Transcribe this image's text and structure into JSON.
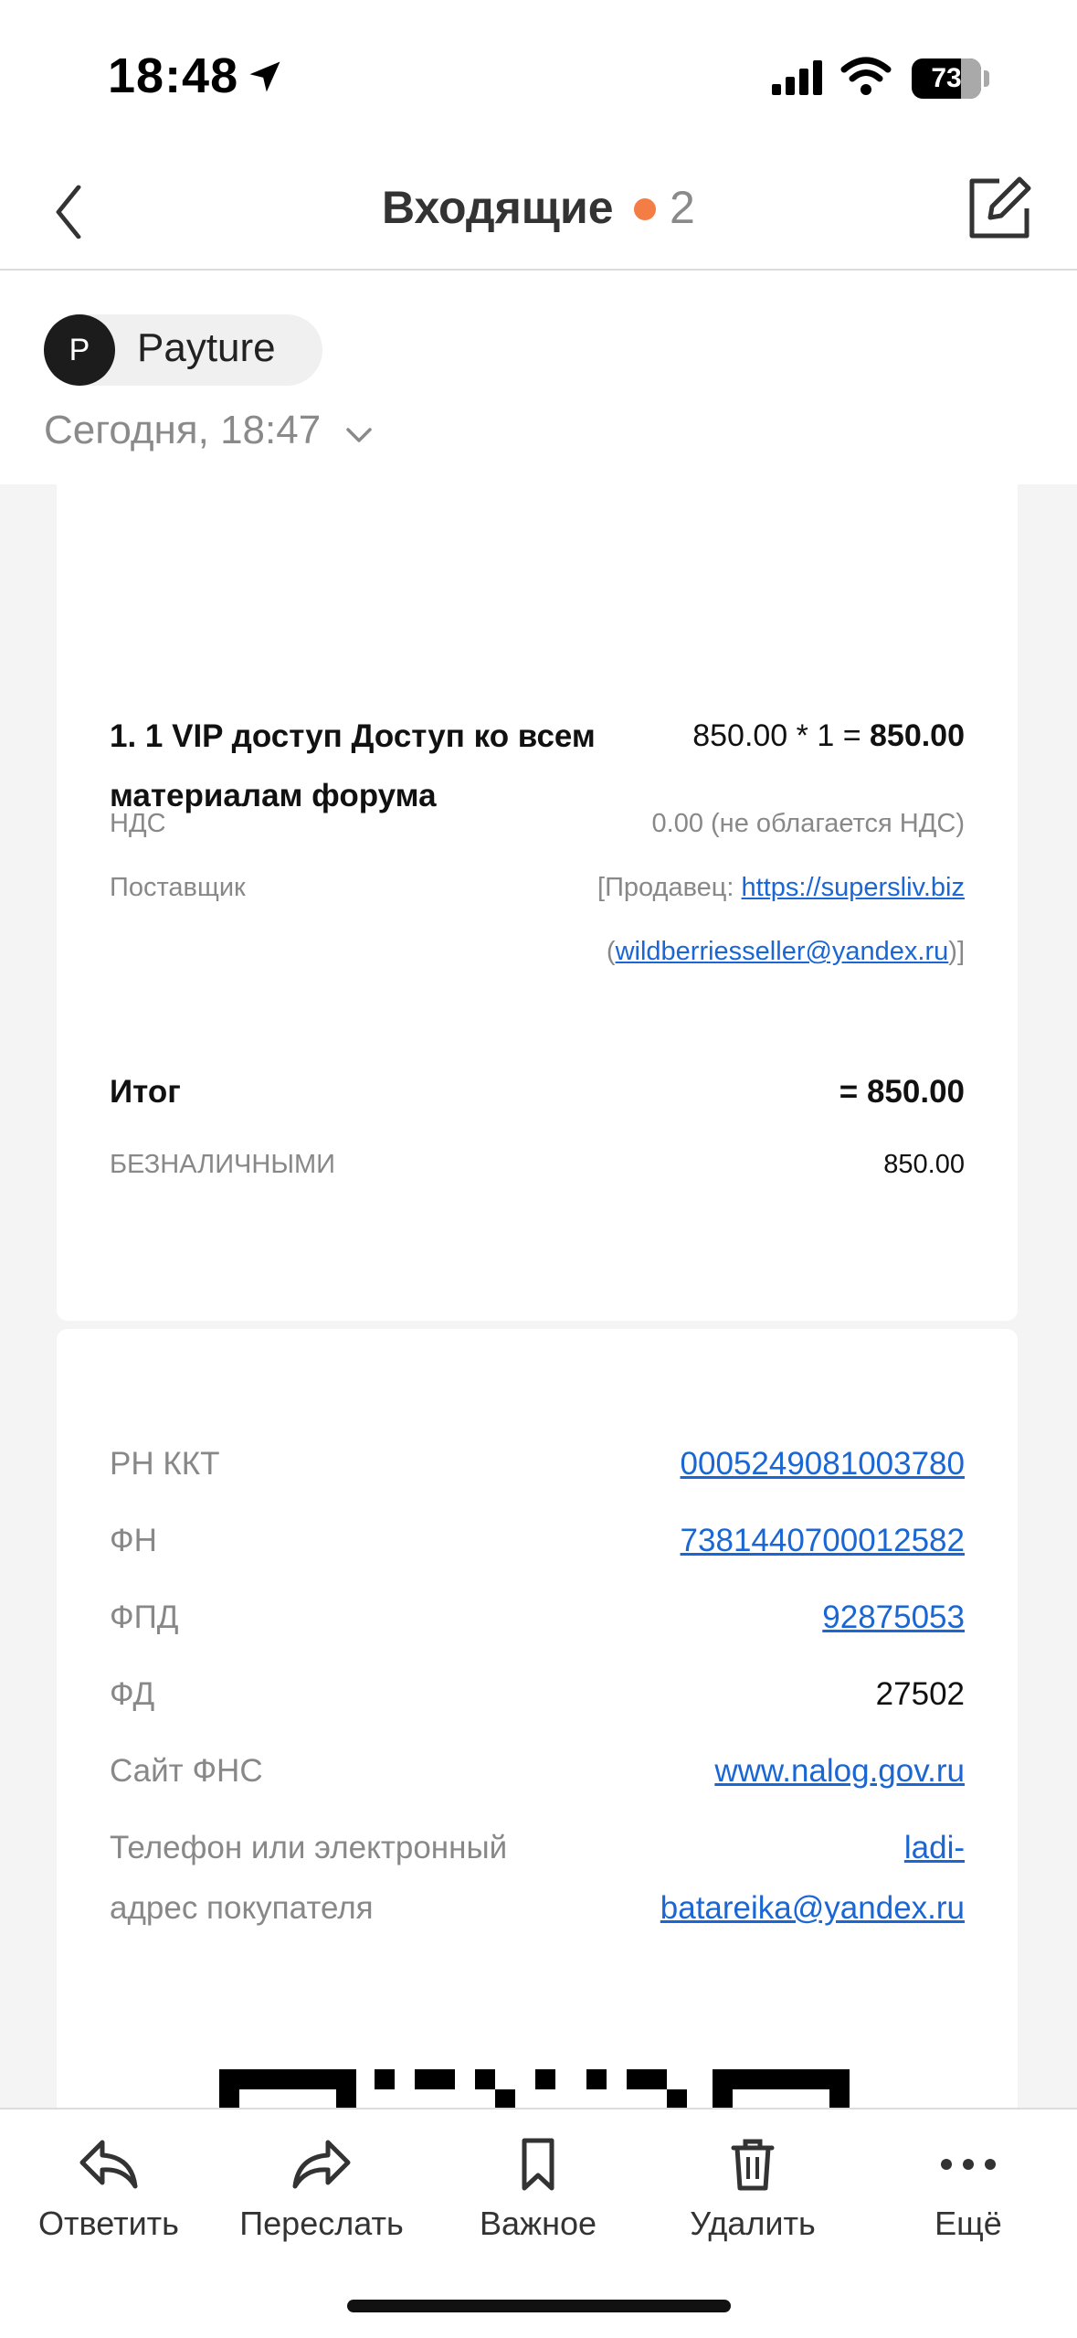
{
  "status_bar": {
    "time": "18:48",
    "battery": "73"
  },
  "nav": {
    "title": "Входящие",
    "unread_count": "2"
  },
  "sender": {
    "initial": "P",
    "name": "Payture",
    "date": "Сегодня, 18:47"
  },
  "receipt": {
    "item": {
      "name": "1. 1 VIP доступ Доступ ко всем материалам форума",
      "price_calc": "850.00 * 1 = ",
      "price_total": "850.00",
      "vat_label": "НДС",
      "vat_value": "0.00 (не облагается НДС)",
      "supplier_label": "Поставщик",
      "supplier_prefix": "[Продавец: ",
      "supplier_site": "https://supersliv.biz",
      "supplier_open": "(",
      "supplier_email": "wildberriesseller@yandex.ru",
      "supplier_close": ")]"
    },
    "total_label": "Итог",
    "total_value": "= 850.00",
    "payment_label": "БЕЗНАЛИЧНЫМИ",
    "payment_value": "850.00",
    "fiscal": [
      {
        "label": "РН ККТ",
        "value": "0005249081003780"
      },
      {
        "label": "ФН",
        "value": "7381440700012582"
      },
      {
        "label": "ФПД",
        "value": "92875053"
      },
      {
        "label": "ФД",
        "value": "27502"
      },
      {
        "label": "Сайт ФНС",
        "value": "www.nalog.gov.ru"
      },
      {
        "label_line1": "Телефон или электронный",
        "label_line2": "адрес покупателя",
        "value_line1": "ladi-",
        "value_line2": "batareika@yandex.ru"
      }
    ]
  },
  "toolbar": {
    "reply": "Ответить",
    "forward": "Переслать",
    "important": "Важное",
    "delete": "Удалить",
    "more": "Ещё"
  },
  "colors": {
    "accent_dot": "#f47c45",
    "link": "#1a66d4"
  },
  "icons": [
    "location-arrow-icon",
    "signal-icon",
    "wifi-icon",
    "battery-icon",
    "back-chevron-icon",
    "compose-icon",
    "chevron-down-icon",
    "reply-icon",
    "forward-icon",
    "bookmark-icon",
    "trash-icon",
    "more-icon"
  ]
}
